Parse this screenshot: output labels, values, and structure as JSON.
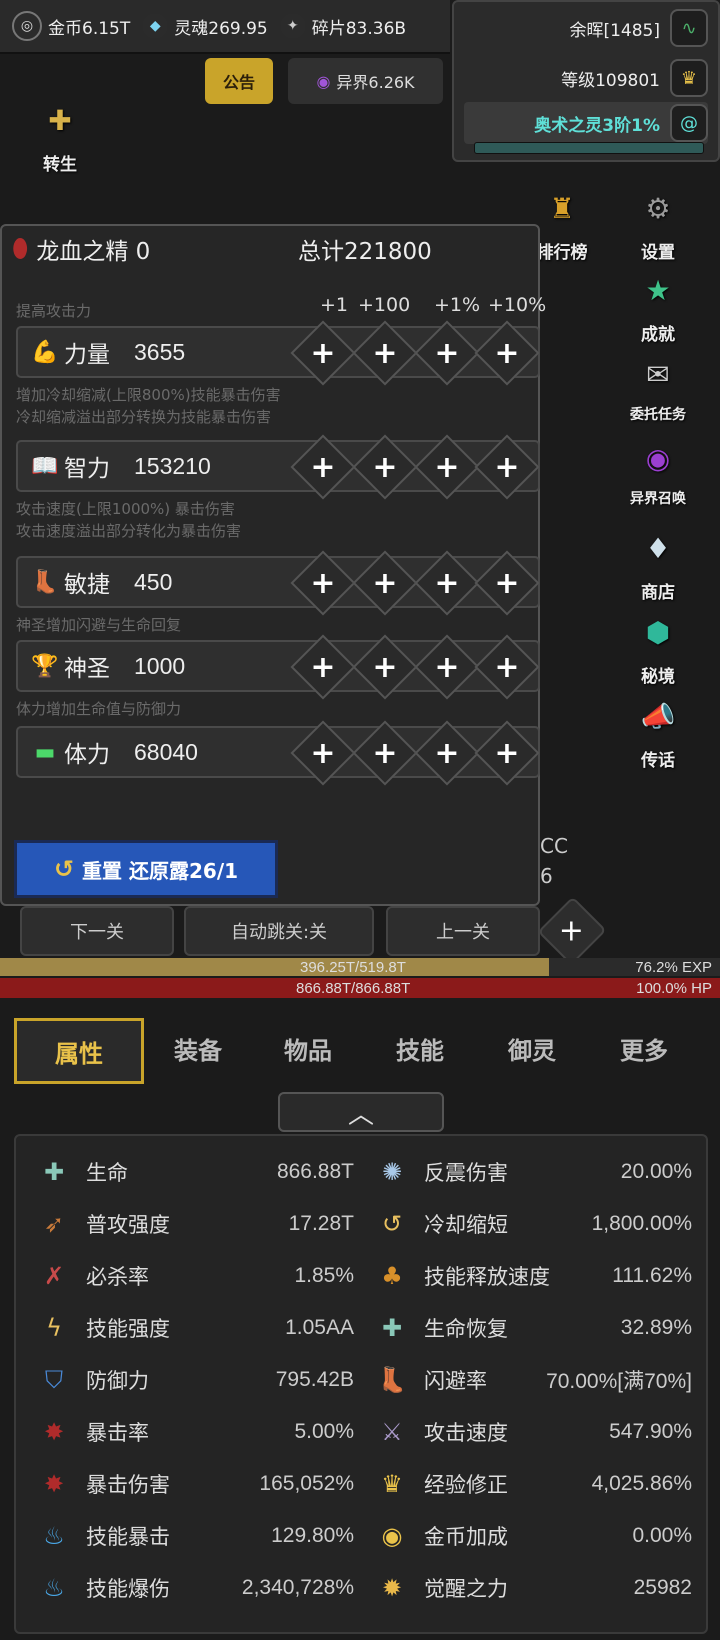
{
  "topbar": {
    "gold": "金币6.15T",
    "soul": "灵魂269.95",
    "fragment": "碎片83.36B",
    "notice": "公告",
    "otherworld": "异界6.26K"
  },
  "right_panel": {
    "afterglow": "余晖[1485]",
    "level": "等级109801",
    "arcane": "奥术之灵3阶1%",
    "arcane_progress": 0.01
  },
  "side_menu": {
    "rebirth": "转生",
    "ranking": "排行榜",
    "settings": "设置",
    "achievement": "成就",
    "commission": "委托任务",
    "summon": "异界召唤",
    "shop": "商店",
    "secret": "秘境",
    "legend": "传话"
  },
  "attr_panel": {
    "essence_label": "龙血之精 0",
    "total_label": "总计221800",
    "increments": [
      "+1",
      "+100",
      "+1%",
      "+10%"
    ],
    "hints": {
      "strength": "提高攻击力",
      "intelligence_1": "增加冷却缩减(上限800%)技能暴击伤害",
      "intelligence_2": "冷却缩减溢出部分转换为技能暴击伤害",
      "agility_1": "攻击速度(上限1000%) 暴击伤害",
      "agility_2": "攻击速度溢出部分转化为暴击伤害",
      "holy": "神圣增加闪避与生命回复",
      "stamina": "体力增加生命值与防御力"
    },
    "stats": [
      {
        "name": "力量",
        "value": "3655"
      },
      {
        "name": "智力",
        "value": "153210"
      },
      {
        "name": "敏捷",
        "value": "450"
      },
      {
        "name": "神圣",
        "value": "1000"
      },
      {
        "name": "体力",
        "value": "68040"
      }
    ],
    "reset": "重置 还原露26/1"
  },
  "stage_nav": {
    "next": "下一关",
    "auto": "自动跳关:关",
    "prev": "上一关",
    "add": "+",
    "side_text1": "CC",
    "side_text2": "6"
  },
  "bars": {
    "exp_text": "396.25T/519.8T",
    "exp_pct": "76.2% EXP",
    "exp_fraction": 0.762,
    "hp_text": "866.88T/866.88T",
    "hp_pct": "100.0%  HP"
  },
  "tabs": [
    "属性",
    "装备",
    "物品",
    "技能",
    "御灵",
    "更多"
  ],
  "stats_left": [
    {
      "name": "生命",
      "value": "866.88T"
    },
    {
      "name": "普攻强度",
      "value": "17.28T"
    },
    {
      "name": "必杀率",
      "value": "1.85%"
    },
    {
      "name": "技能强度",
      "value": "1.05AA"
    },
    {
      "name": "防御力",
      "value": "795.42B"
    },
    {
      "name": "暴击率",
      "value": "5.00%"
    },
    {
      "name": "暴击伤害",
      "value": "165,052%"
    },
    {
      "name": "技能暴击",
      "value": "129.80%"
    },
    {
      "name": "技能爆伤",
      "value": "2,340,728%"
    }
  ],
  "stats_right": [
    {
      "name": "反震伤害",
      "value": "20.00%"
    },
    {
      "name": "冷却缩短",
      "value": "1,800.00%"
    },
    {
      "name": "技能释放速度",
      "value": "111.62%"
    },
    {
      "name": "生命恢复",
      "value": "32.89%"
    },
    {
      "name": "闪避率",
      "value": "70.00%[满70%]"
    },
    {
      "name": "攻击速度",
      "value": "547.90%"
    },
    {
      "name": "经验修正",
      "value": "4,025.86%"
    },
    {
      "name": "金币加成",
      "value": "0.00%"
    },
    {
      "name": "觉醒之力",
      "value": "25982"
    }
  ]
}
